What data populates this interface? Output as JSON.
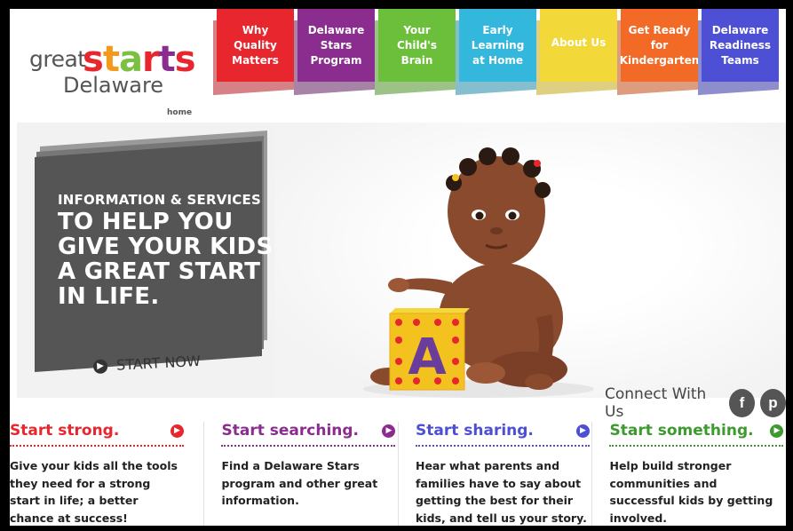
{
  "logo": {
    "great": "great",
    "starts": [
      "s",
      "t",
      "a",
      "r",
      "t",
      "s"
    ],
    "delaware": "Delaware"
  },
  "colors": {
    "starts": [
      "#e8262e",
      "#f39a1e",
      "#7bbf43",
      "#e8262e",
      "#8b2d8f",
      "#e8262e"
    ],
    "nav": [
      "#e8262e",
      "#8b2d8f",
      "#6cbf3a",
      "#33b7dc",
      "#f3d83a",
      "#f36a27",
      "#4d4fd4"
    ],
    "strong": "#e8262e",
    "searching": "#8b2d8f",
    "sharing": "#4d4fd4",
    "something": "#3c9a2e"
  },
  "nav": [
    {
      "lines": [
        "Why",
        "Quality",
        "Matters"
      ]
    },
    {
      "lines": [
        "Delaware",
        "Stars",
        "Program"
      ]
    },
    {
      "lines": [
        "Your",
        "Child's",
        "Brain"
      ]
    },
    {
      "lines": [
        "Early",
        "Learning",
        "at Home"
      ]
    },
    {
      "lines": [
        "About Us"
      ]
    },
    {
      "lines": [
        "Get Ready",
        "for",
        "Kindergarten"
      ]
    },
    {
      "lines": [
        "Delaware",
        "Readiness",
        "Teams"
      ]
    }
  ],
  "breadcrumb": "home",
  "hero": {
    "small": "INFORMATION & SERVICES",
    "big": [
      "TO HELP YOU",
      "GIVE YOUR KIDS",
      "A GREAT START",
      "IN LIFE."
    ],
    "cta": "START NOW",
    "block_letter": "A"
  },
  "connect": {
    "label": "Connect With Us",
    "facebook": "f",
    "pinterest": "p"
  },
  "columns": [
    {
      "title": "Start strong.",
      "text": "Give your kids all the tools they need for a strong start in life; a better chance at success!"
    },
    {
      "title": "Start searching.",
      "text": "Find a Delaware Stars program and other great information."
    },
    {
      "title": "Start sharing.",
      "text": "Hear what parents and families have to say about getting the best for their kids, and tell us your story."
    },
    {
      "title": "Start something.",
      "text": "Help build stronger communities and successful kids by getting involved."
    }
  ]
}
